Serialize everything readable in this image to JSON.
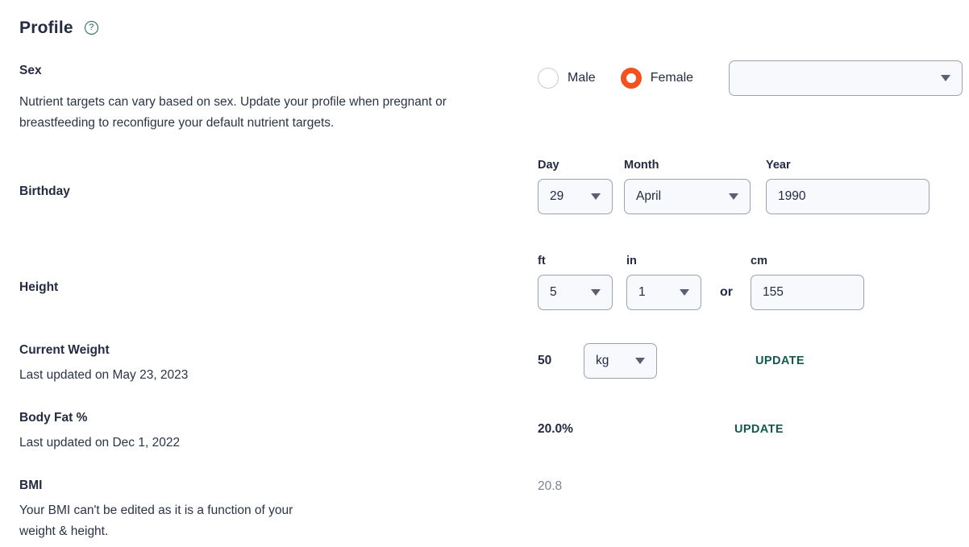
{
  "header": {
    "title": "Profile",
    "help_icon": "help-circle-icon",
    "help_glyph": "?"
  },
  "colors": {
    "accent_orange": "#f4511e",
    "link_teal": "#14594e",
    "text_dark": "#242b42",
    "text_muted": "#7b8394",
    "field_fill": "#f7f9fc",
    "field_border": "#9ba2ae"
  },
  "sections": {
    "sex": {
      "label": "Sex",
      "description": "Nutrient targets can vary based on sex. Update your profile when pregnant or breastfeeding to reconfigure your default nutrient targets.",
      "options": [
        {
          "label": "Male",
          "checked": false
        },
        {
          "label": "Female",
          "checked": true
        }
      ],
      "status_select": {
        "value": "",
        "placeholder": ""
      }
    },
    "birthday": {
      "label": "Birthday",
      "day": {
        "sub_label": "Day",
        "value": "29"
      },
      "month": {
        "sub_label": "Month",
        "value": "April"
      },
      "year": {
        "sub_label": "Year",
        "value": "1990"
      }
    },
    "height": {
      "label": "Height",
      "ft": {
        "sub_label": "ft",
        "value": "5"
      },
      "in": {
        "sub_label": "in",
        "value": "1"
      },
      "separator": "or",
      "cm": {
        "sub_label": "cm",
        "value": "155"
      }
    },
    "current_weight": {
      "label": "Current Weight",
      "description": "Last updated on May 23, 2023",
      "value": "50",
      "unit": "kg",
      "update_label": "UPDATE"
    },
    "body_fat": {
      "label": "Body Fat %",
      "description": "Last updated on Dec 1, 2022",
      "value": "20.0%",
      "update_label": "UPDATE"
    },
    "bmi": {
      "label": "BMI",
      "description": "Your BMI can't be edited as it is a function of your weight & height.",
      "value": "20.8"
    }
  }
}
